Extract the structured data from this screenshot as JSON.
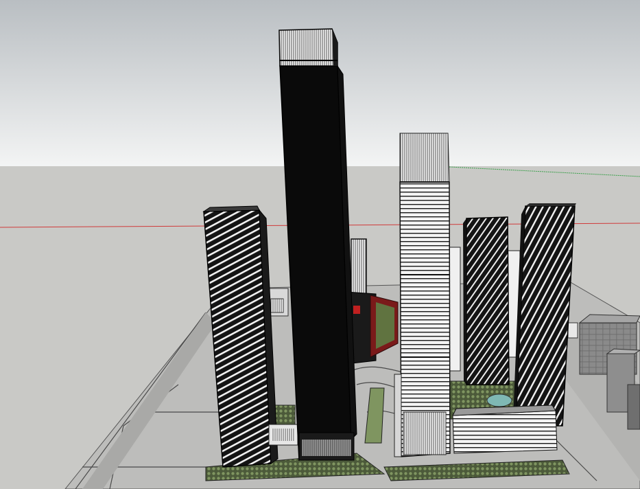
{
  "scene": {
    "kind": "3d-architectural-model-viewport",
    "colors": {
      "sky_top": "#b9bec2",
      "sky_bottom": "#f3f4f4",
      "ground": "#c9c9c6",
      "site_plate": "#bdbdbb",
      "road": "#9a9a98",
      "axis_red": "#d03a3a",
      "axis_green": "#3aa04a",
      "tower_dark": "#0a0a0a",
      "tower_white": "#f4f4f4",
      "vegetation": "#6e7f55",
      "podium_red": "#7a1a1a",
      "pool": "#7fb8b4"
    },
    "objects": [
      "tall-black-tower",
      "white-striped-tower",
      "left-patterned-tower",
      "right-patterned-tower",
      "middle-patterned-tower",
      "podium-block",
      "landscape-planting",
      "road-network",
      "neighbouring-blocks",
      "red-axis-line",
      "green-axis-line"
    ]
  }
}
